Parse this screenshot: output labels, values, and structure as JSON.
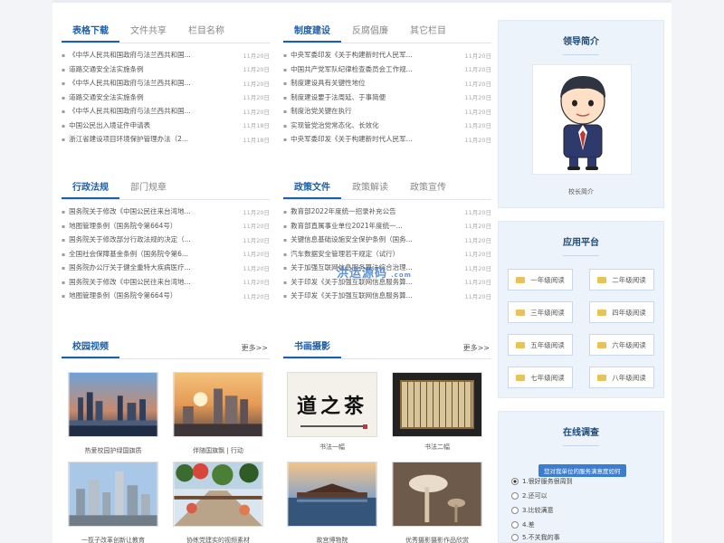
{
  "p1": {
    "tabs": [
      "表格下载",
      "文件共享",
      "栏目名称"
    ],
    "items": [
      {
        "t": "《中华人民共和国政府与法兰西共和国...",
        "d": "11月20日"
      },
      {
        "t": "道路交通安全法实施条例",
        "d": "11月20日"
      },
      {
        "t": "《中华人民共和国政府与法兰西共和国...",
        "d": "11月20日"
      },
      {
        "t": "道路交通安全法实施条例",
        "d": "11月20日"
      },
      {
        "t": "《中华人民共和国政府与法兰西共和国...",
        "d": "11月20日"
      },
      {
        "t": "中国公民出入境证件申请表",
        "d": "11月18日"
      },
      {
        "t": "浙江省建设项目环境保护管理办法（2...",
        "d": "11月18日"
      }
    ]
  },
  "p2": {
    "tabs": [
      "制度建设",
      "反腐倡廉",
      "其它栏目"
    ],
    "items": [
      {
        "t": "中央军委印发《关于构建新时代人民军...",
        "d": "11月20日"
      },
      {
        "t": "中国共产党军队纪律检查委员会工作规...",
        "d": "11月20日"
      },
      {
        "t": "制度建设具有关键性地位",
        "d": "11月20日"
      },
      {
        "t": "制度建设要于法周延、于事简便",
        "d": "11月20日"
      },
      {
        "t": "制度治党关键在执行",
        "d": "11月20日"
      },
      {
        "t": "实现管党治党常态化、长效化",
        "d": "11月20日"
      },
      {
        "t": "中央军委印发《关于构建新时代人民军...",
        "d": "11月20日"
      }
    ]
  },
  "p3": {
    "tabs": [
      "行政法规",
      "部门规章"
    ],
    "items": [
      {
        "t": "国务院关于修改《中国公民往来台湾地...",
        "d": "11月20日"
      },
      {
        "t": "地图管理条例（国务院令第664号）",
        "d": "11月20日"
      },
      {
        "t": "国务院关于修改部分行政法规的决定（...",
        "d": "11月20日"
      },
      {
        "t": "全国社会保障基金条例（国务院令第6...",
        "d": "11月20日"
      },
      {
        "t": "国务院办公厅关于健全重特大疾病医疗...",
        "d": "11月20日"
      },
      {
        "t": "国务院关于修改《中国公民往来台湾地...",
        "d": "11月20日"
      },
      {
        "t": "地图管理条例（国务院令第664号）",
        "d": "11月20日"
      }
    ]
  },
  "p4": {
    "tabs": [
      "政策文件",
      "政策解读",
      "政策宣传"
    ],
    "items": [
      {
        "t": "教育部2022年度统一招录补充公告",
        "d": "11月20日"
      },
      {
        "t": "教育部直属事业单位2021年度统一...",
        "d": "11月20日"
      },
      {
        "t": "关键信息基础设施安全保护条例（国务...",
        "d": "11月20日"
      },
      {
        "t": "汽车数据安全管理若干规定（试行）",
        "d": "11月20日"
      },
      {
        "t": "关于加强互联网信息服务算法综合治理...",
        "d": "11月20日"
      },
      {
        "t": "关于印发《关于加强互联网信息服务算...",
        "d": "11月20日"
      },
      {
        "t": "关于印发《关于加强互联网信息服务算...",
        "d": "11月20日"
      }
    ]
  },
  "video": {
    "title": "校园视频",
    "more": "更多>>",
    "items": [
      "热爱校园护绿国旗质",
      "伴随国旗飘 | 行动",
      "一揽子改革创新让教育",
      "协练党建实的视频素材"
    ]
  },
  "art": {
    "title": "书画摄影",
    "more": "更多>>",
    "items": [
      "书法一幅",
      "书法二幅",
      "故宫博物院",
      "优秀摄影摄影作品欣赏"
    ],
    "calligraphy": "道之茶"
  },
  "leader": {
    "title": "领导简介",
    "caption": "校长简介"
  },
  "platform": {
    "title": "应用平台",
    "buttons": [
      "一年级阅读",
      "二年级阅读",
      "三年级阅读",
      "四年级阅读",
      "五年级阅读",
      "六年级阅读",
      "七年级阅读",
      "八年级阅读"
    ]
  },
  "survey": {
    "title": "在线调查",
    "question": "您对我单位的服务满意度如何",
    "options": [
      "1.很好服务很周到",
      "2.还可以",
      "3.比较满意",
      "4.差",
      "5.不关我的事"
    ],
    "selected": 0
  },
  "watermark": {
    "text": "洪运源码",
    "sub": ".com"
  }
}
